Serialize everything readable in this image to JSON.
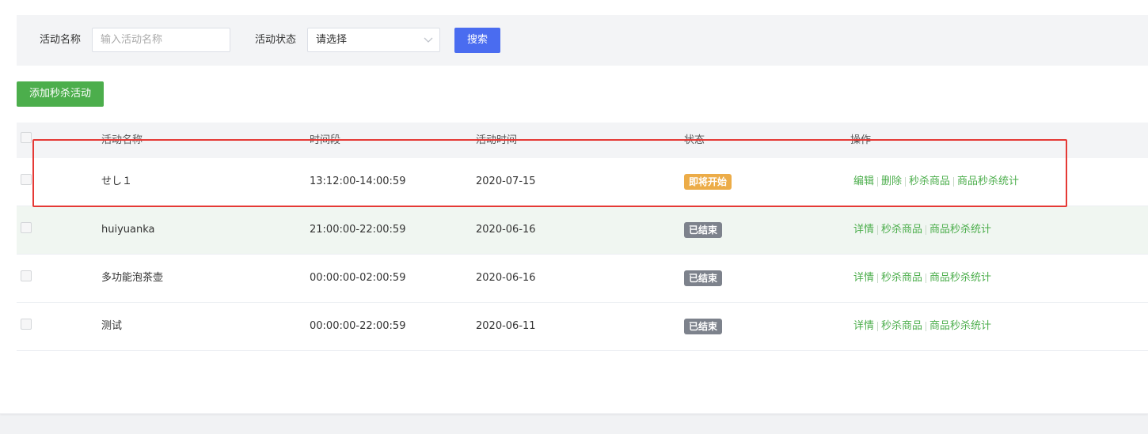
{
  "search": {
    "name_label": "活动名称",
    "name_placeholder": "输入活动名称",
    "status_label": "活动状态",
    "status_value": "请选择",
    "search_button": "搜索"
  },
  "toolbar": {
    "add_button": "添加秒杀活动"
  },
  "table": {
    "headers": {
      "name": "活动名称",
      "time": "时间段",
      "date": "活动时间",
      "status": "状态",
      "ops": "操作"
    },
    "rows": [
      {
        "name": "せし１",
        "time": "13:12:00-14:00:59",
        "date": "2020-07-15",
        "status": "即将开始",
        "status_color": "#ecac48",
        "ops": [
          "编辑",
          "删除",
          "秒杀商品",
          "商品秒杀统计"
        ]
      },
      {
        "name": "huiyuanka",
        "time": "21:00:00-22:00:59",
        "date": "2020-06-16",
        "status": "已结束",
        "status_color": "#7d828c",
        "ops": [
          "详情",
          "秒杀商品",
          "商品秒杀统计"
        ]
      },
      {
        "name": "多功能泡茶壶",
        "time": "00:00:00-02:00:59",
        "date": "2020-06-16",
        "status": "已结束",
        "status_color": "#7d828c",
        "ops": [
          "详情",
          "秒杀商品",
          "商品秒杀统计"
        ]
      },
      {
        "name": "测试",
        "time": "00:00:00-22:00:59",
        "date": "2020-06-11",
        "status": "已结束",
        "status_color": "#7d828c",
        "ops": [
          "详情",
          "秒杀商品",
          "商品秒杀统计"
        ]
      }
    ]
  },
  "colors": {
    "accent": "#4a6cf0",
    "add": "#4cae4c",
    "link": "#4cae4c",
    "annotation": "#e53935"
  }
}
